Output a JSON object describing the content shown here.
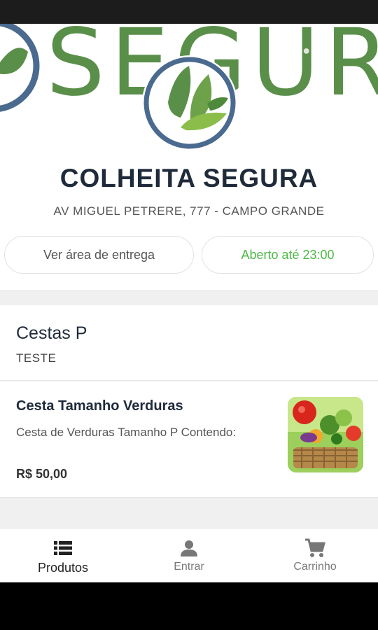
{
  "banner": {
    "text": "SEGUR"
  },
  "store": {
    "name": "COLHEITA SEGURA",
    "address": "AV MIGUEL PETRERE, 777 - CAMPO GRANDE",
    "delivery_label": "Ver área de entrega",
    "hours_label": "Aberto até 23:00"
  },
  "category": {
    "title": "Cestas P",
    "description": "TESTE"
  },
  "products": [
    {
      "name": "Cesta Tamanho Verduras",
      "description": "Cesta de Verduras Tamanho P Contendo:",
      "price": "R$ 50,00"
    }
  ],
  "bottom_nav": [
    {
      "label": "Produtos",
      "icon": "list-icon",
      "active": true
    },
    {
      "label": "Entrar",
      "icon": "person-icon",
      "active": false
    },
    {
      "label": "Carrinho",
      "icon": "cart-icon",
      "active": false
    }
  ],
  "colors": {
    "brand_green": "#5a8f4a",
    "logo_blue": "#4a6a8f",
    "open_green": "#4cb944",
    "title_dark": "#1f2a3a"
  }
}
